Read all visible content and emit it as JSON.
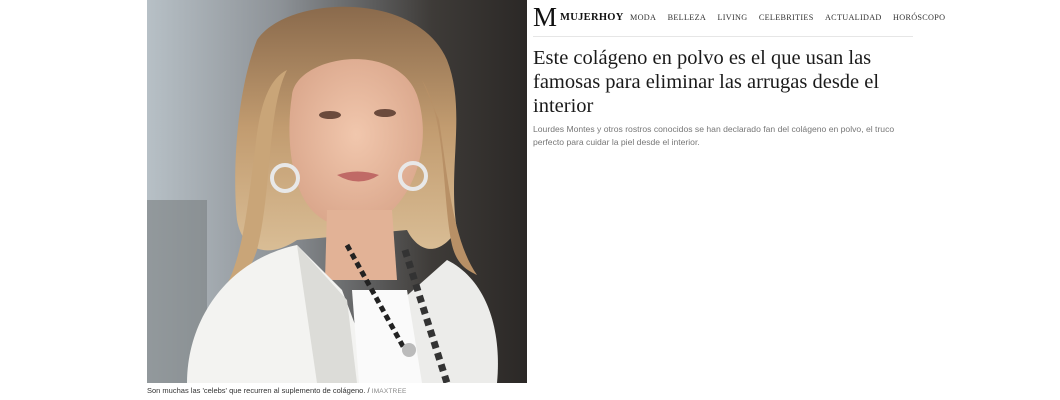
{
  "brand": {
    "mark": "M",
    "name": "MUJERHOY"
  },
  "nav": {
    "items": [
      "MODA",
      "BELLEZA",
      "LIVING",
      "CELEBRITIES",
      "ACTUALIDAD",
      "HORÓSCOPO"
    ]
  },
  "article": {
    "title": "Este colágeno en polvo es el que usan las famosas para eliminar las arrugas desde el interior",
    "subtitle": "Lourdes Montes y otros rostros conocidos se han declarado fan del colágeno en polvo, el truco perfecto para cuidar la piel desde el interior."
  },
  "photo": {
    "caption": "Son muchas las 'celebs' que recurren al suplemento de colágeno. /",
    "credit": "IMAXTREE"
  },
  "icons": {
    "gallery": "gallery-icon"
  },
  "colors": {
    "accent": "#9b1b2b",
    "text": "#1a1a1a",
    "muted": "#777777"
  }
}
